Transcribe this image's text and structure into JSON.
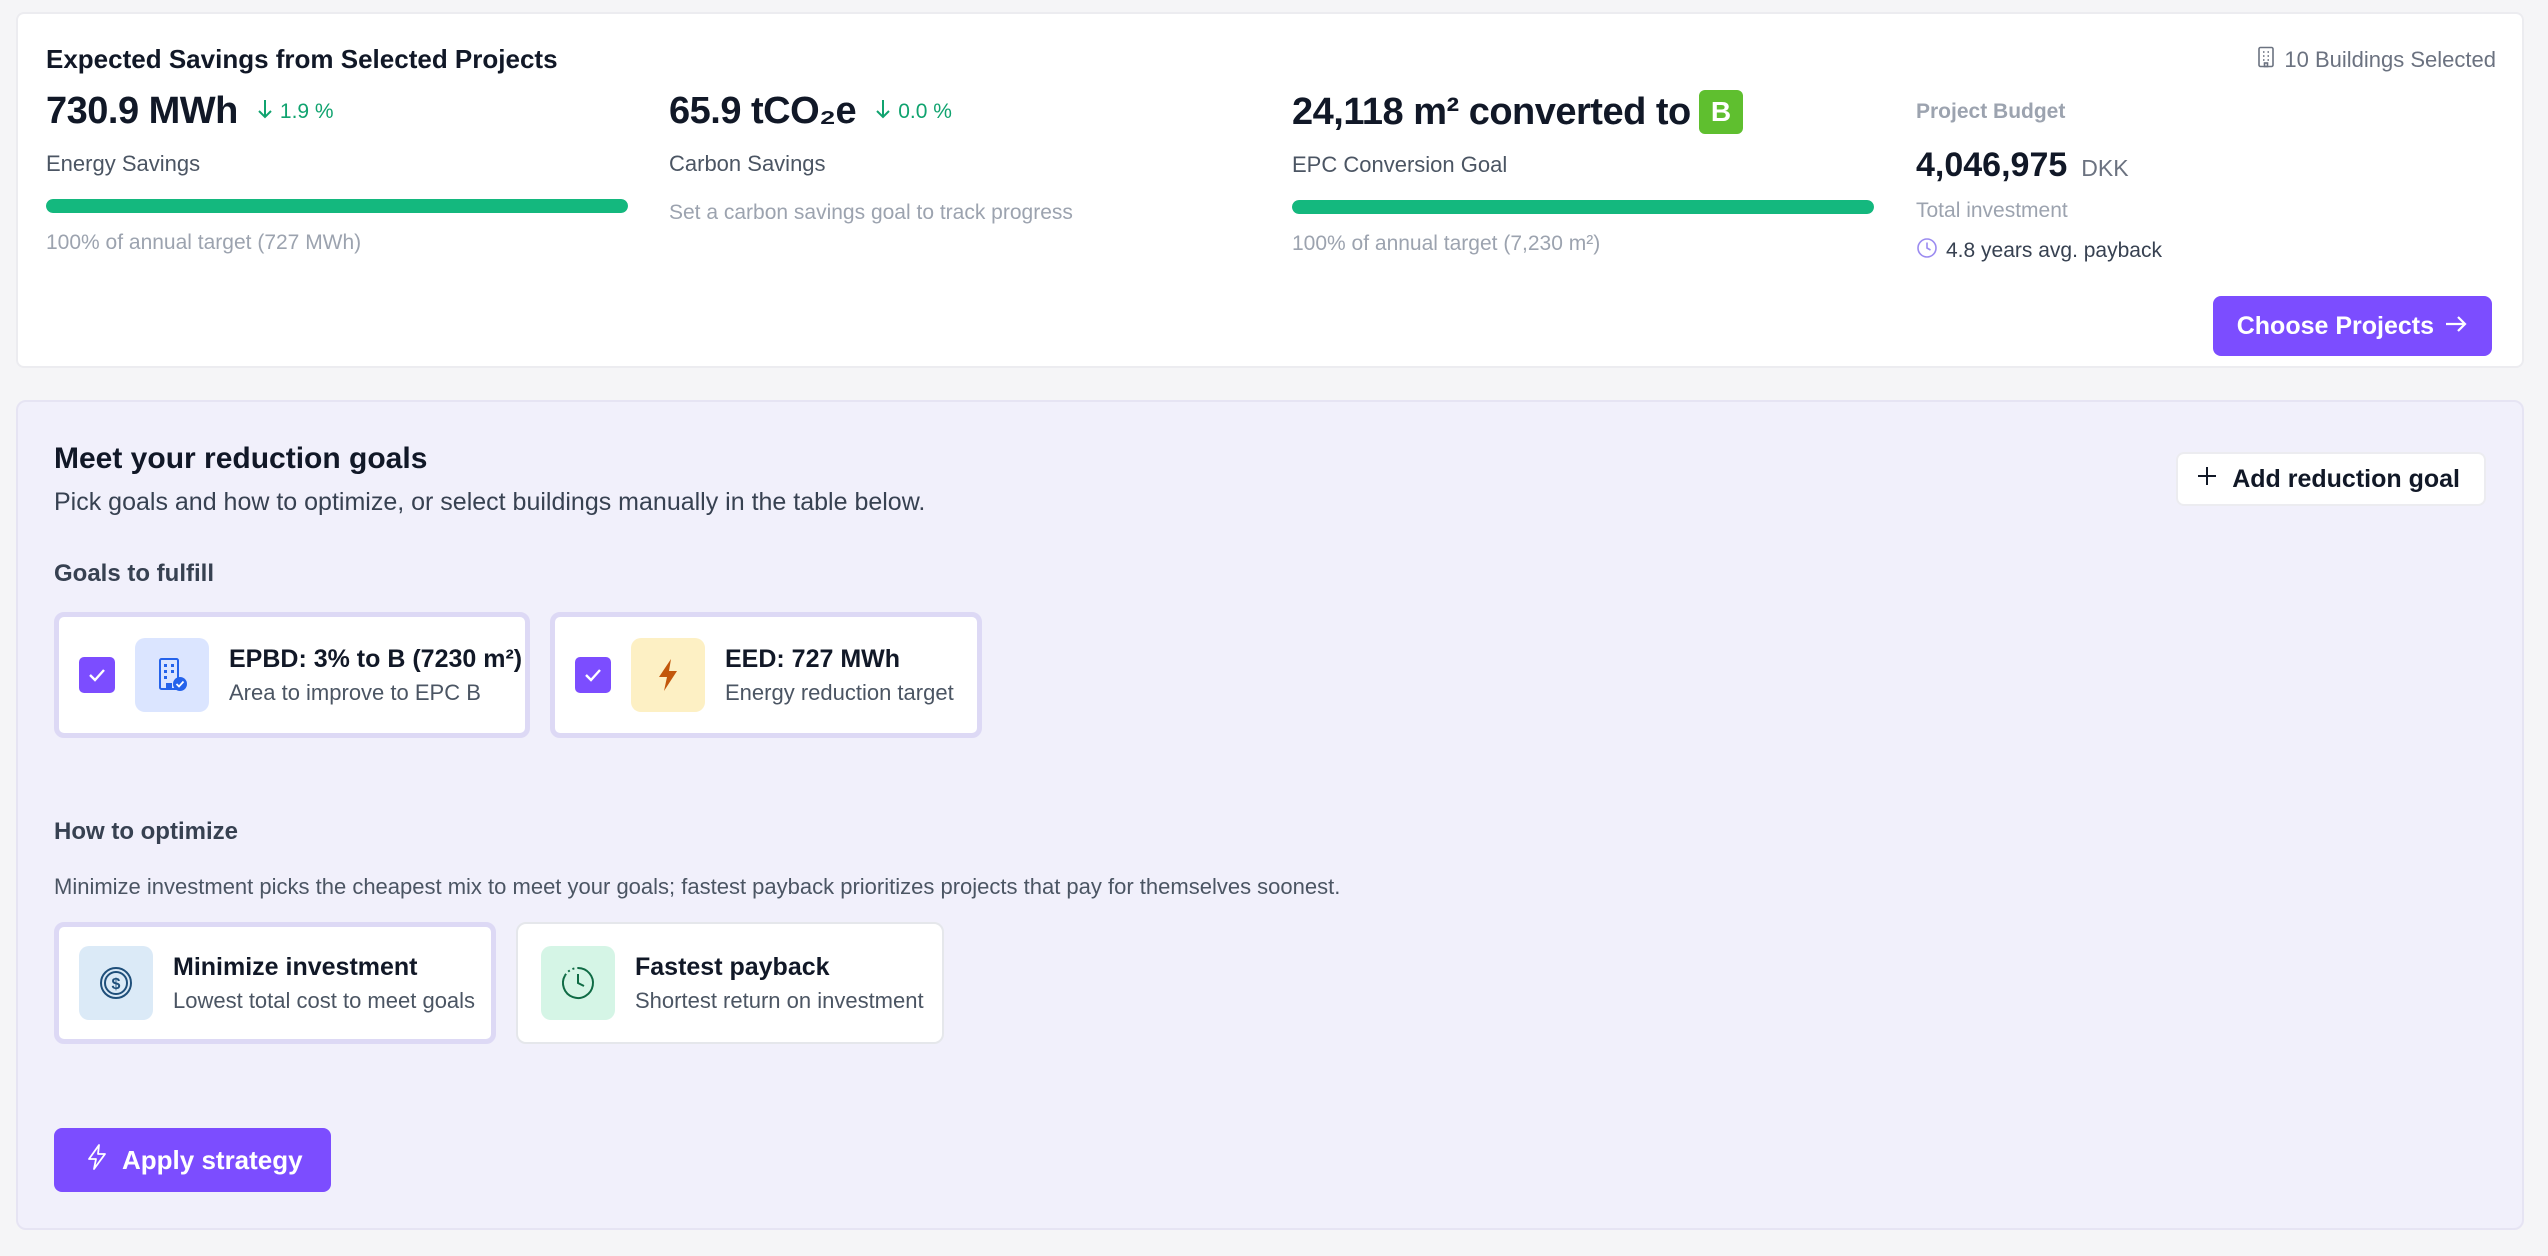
{
  "savings": {
    "title": "Expected Savings from Selected Projects",
    "buildings_selected": "10 Buildings Selected",
    "energy": {
      "value": "730.9 MWh",
      "delta": "1.9 %",
      "label": "Energy Savings",
      "progress_percent": 100,
      "footnote": "100% of annual target (727 MWh)"
    },
    "carbon": {
      "value": "65.9 tCO₂e",
      "delta": "0.0 %",
      "label": "Carbon Savings",
      "hint": "Set a carbon savings goal to track progress"
    },
    "epc": {
      "value": "24,118 m² converted to",
      "badge": "B",
      "label": "EPC Conversion Goal",
      "progress_percent": 100,
      "footnote": "100% of annual target (7,230 m²)"
    },
    "budget": {
      "label": "Project Budget",
      "amount": "4,046,975",
      "currency": "DKK",
      "total_label": "Total investment",
      "payback": "4.8 years avg. payback"
    },
    "choose_button": "Choose Projects"
  },
  "goals": {
    "title": "Meet your reduction goals",
    "description": "Pick goals and how to optimize, or select buildings manually in the table below.",
    "add_button": "Add reduction goal",
    "fulfill_label": "Goals to fulfill",
    "items": [
      {
        "name": "EPBD: 3% to B (7230 m²)",
        "sub": "Area to improve to EPC B",
        "checked": true,
        "icon": "building-check-icon"
      },
      {
        "name": "EED: 727 MWh",
        "sub": "Energy reduction target",
        "checked": true,
        "icon": "lightning-icon"
      }
    ],
    "optimize_label": "How to optimize",
    "optimize_description": "Minimize investment picks the cheapest mix to meet your goals; fastest payback prioritizes projects that pay for themselves soonest.",
    "options": [
      {
        "name": "Minimize investment",
        "sub": "Lowest total cost to meet goals",
        "selected": true,
        "icon": "dollar-circle-icon"
      },
      {
        "name": "Fastest payback",
        "sub": "Shortest return on investment",
        "selected": false,
        "icon": "clock-icon"
      }
    ],
    "apply_button": "Apply strategy"
  },
  "colors": {
    "accent": "#7c4dff",
    "progress": "#14b87e",
    "epc_b": "#5fbf2f",
    "delta": "#10a36f"
  }
}
